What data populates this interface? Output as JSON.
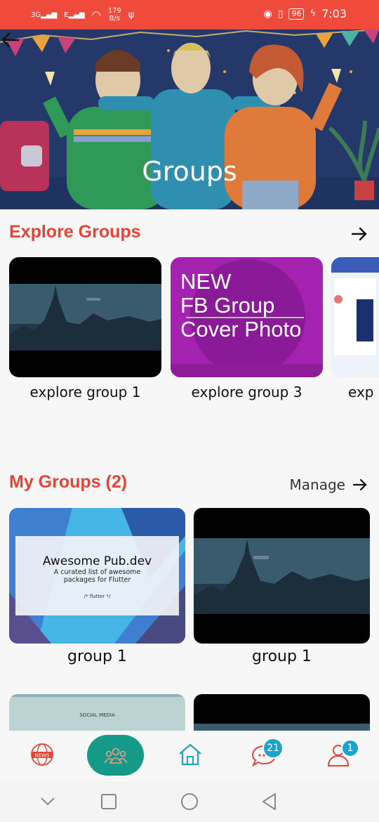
{
  "status_bar": {
    "net_speed_value": "179",
    "net_speed_unit": "B/s",
    "battery": "96",
    "time": "7:03",
    "signal_1": "3G",
    "signal_2": "E"
  },
  "header": {
    "title": "Groups"
  },
  "explore": {
    "title": "Explore Groups",
    "cards": [
      {
        "label": "explore group 1"
      },
      {
        "label": "explore group 3",
        "image_text": [
          "NEW",
          "FB Group",
          "Cover Photo"
        ]
      },
      {
        "label": "exp"
      }
    ]
  },
  "my_groups": {
    "title": "My Groups (2)",
    "manage_label": "Manage",
    "cards": [
      {
        "label": "group 1",
        "card_title": "Awesome Pub.dev",
        "card_subtitle_1": "A curated list of awesome",
        "card_subtitle_2": "packages for Flutter",
        "card_code": "/* flutter */"
      },
      {
        "label": "group 1"
      }
    ],
    "partial_cards": [
      {
        "image_text": "SOCIAL MEDIA"
      }
    ]
  },
  "bottom_nav": {
    "news_label": "NEWS",
    "chat_badge": "21",
    "profile_badge": "1"
  },
  "colors": {
    "accent": "#e64334",
    "status_bar": "#f04a3d",
    "teal": "#159a8a",
    "badge": "#1da3c9"
  }
}
